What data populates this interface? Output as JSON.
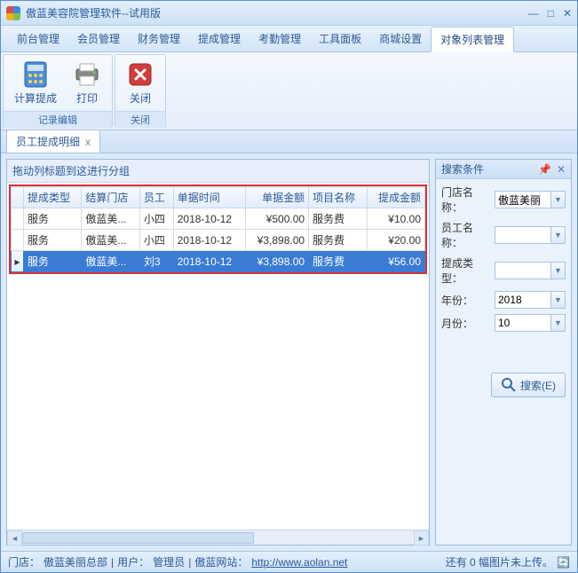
{
  "window": {
    "title": "傲蓝美容院管理软件--试用版"
  },
  "menu": {
    "items": [
      "前台管理",
      "会员管理",
      "财务管理",
      "提成管理",
      "考勤管理",
      "工具面板",
      "商城设置",
      "对象列表管理"
    ],
    "active_index": 7
  },
  "ribbon": {
    "group1": {
      "label": "记录编辑",
      "btn_calc": "计算提成",
      "btn_print": "打印"
    },
    "group2": {
      "label": "关闭",
      "btn_close": "关闭"
    }
  },
  "tab": {
    "label": "员工提成明细",
    "close": "x"
  },
  "grid": {
    "group_hint": "拖动列标题到这进行分组",
    "columns": [
      "提成类型",
      "结算门店",
      "员工",
      "单据时间",
      "单据金额",
      "项目名称",
      "提成金额"
    ],
    "rows": [
      {
        "type": "服务",
        "store": "傲蓝美...",
        "emp": "小四",
        "date": "2018-10-12",
        "amount": "¥500.00",
        "item": "服务费",
        "commission": "¥10.00",
        "selected": false
      },
      {
        "type": "服务",
        "store": "傲蓝美...",
        "emp": "小四",
        "date": "2018-10-12",
        "amount": "¥3,898.00",
        "item": "服务费",
        "commission": "¥20.00",
        "selected": false
      },
      {
        "type": "服务",
        "store": "傲蓝美...",
        "emp": "刘3",
        "date": "2018-10-12",
        "amount": "¥3,898.00",
        "item": "服务费",
        "commission": "¥56.00",
        "selected": true
      }
    ]
  },
  "search": {
    "title": "搜索条件",
    "fields": {
      "store_label": "门店名称：",
      "store_value": "傲蓝美丽",
      "emp_label": "员工名称：",
      "emp_value": "",
      "type_label": "提成类型：",
      "type_value": "",
      "year_label": "年份：",
      "year_value": "2018",
      "month_label": "月份：",
      "month_value": "10"
    },
    "button": "搜索(E)"
  },
  "status": {
    "store_label": "门店：",
    "store": "傲蓝美丽总部",
    "user_label": "用户：",
    "user": "管理员",
    "site_label": "傲蓝网站：",
    "site_url": "http://www.aolan.net",
    "right": "还有 0 幅图片未上传。"
  }
}
